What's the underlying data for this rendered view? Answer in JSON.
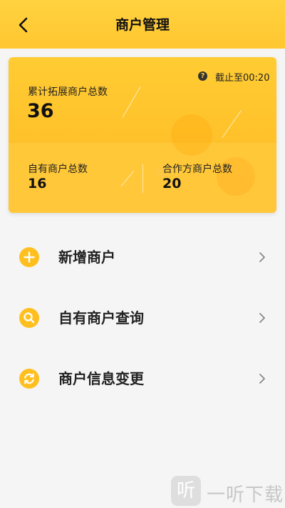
{
  "header": {
    "title": "商户管理",
    "back_icon": "chevron-left-icon"
  },
  "summary_card": {
    "deadline": "截止至00:20",
    "help_icon": "question-circle-icon",
    "help_glyph": "?",
    "total_label": "累计拓展商户总数",
    "total_value": "36",
    "own_label": "自有商户总数",
    "own_value": "16",
    "partner_label": "合作方商户总数",
    "partner_value": "20"
  },
  "menu": {
    "items": [
      {
        "label": "新增商户",
        "icon": "plus-circle-icon"
      },
      {
        "label": "自有商户查询",
        "icon": "search-circle-icon"
      },
      {
        "label": "商户信息变更",
        "icon": "refresh-circle-icon"
      }
    ]
  },
  "watermark": {
    "logo_glyph": "听",
    "text": "一听下载"
  },
  "colors": {
    "accent": "#ffc52f",
    "icon_yellow": "#ffbf1f"
  }
}
